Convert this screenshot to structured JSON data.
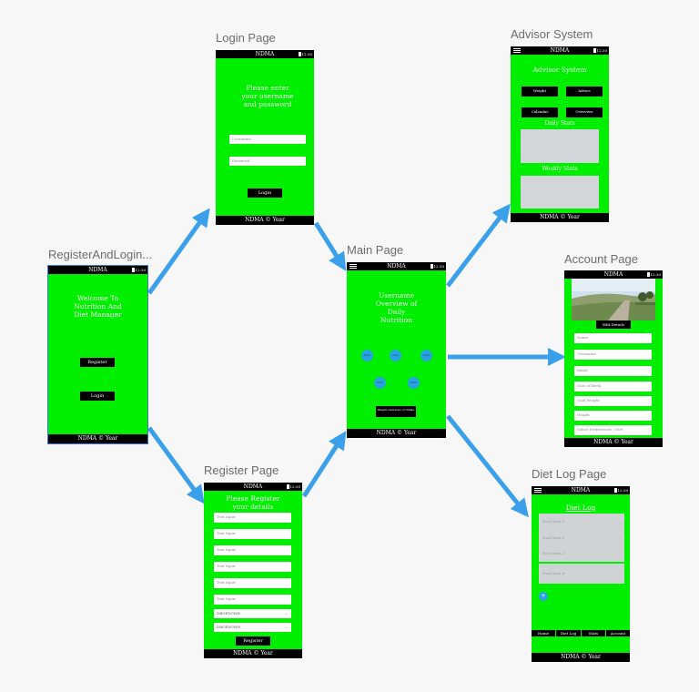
{
  "colors": {
    "screen": "#00ee00",
    "arrow": "#3aa0ea",
    "bar": "#000000"
  },
  "app": {
    "status_title": "NDMA",
    "status_time": "12:30",
    "footer": "NDMA © Year"
  },
  "screens": {
    "register_login": {
      "label": "RegisterAndLogin...",
      "title": "Welcome To Nutrition And Diet Manager",
      "register_button": "Register",
      "login_button": "Login"
    },
    "login": {
      "label": "Login Page",
      "title": "Please enter your username and password",
      "username_placeholder": "Username",
      "password_placeholder": "Password",
      "login_button": "Login"
    },
    "register": {
      "label": "Register Page",
      "title": "Please Register your details",
      "fields": [
        "Text Input",
        "Text Input",
        "Text Input",
        "Text Input",
        "Text Input",
        "Text Input"
      ],
      "dropdowns": [
        "DROPDOWN",
        "DROPDOWN"
      ],
      "register_button": "Register"
    },
    "main": {
      "label": "Main Page",
      "title": "Username Overview of Daily Nutrition",
      "circles": [
        "Item",
        "Item",
        "Item",
        "Item",
        "Item"
      ],
      "overview_button": "Weight Overview of Intake"
    },
    "advisor": {
      "label": "Advisor System",
      "title": "Advisor System",
      "buttons": [
        "Weight",
        "Advice",
        "Calendar",
        "Overview"
      ],
      "daily_stats": "Daily Stats",
      "weekly_stats": "Weekly Stats"
    },
    "account": {
      "label": "Account Page",
      "edit_button": "Edit Details",
      "fields": [
        "Name",
        "Username",
        "Email",
        "Date of Birth",
        "Goal Weight",
        "Height",
        "Select Preferences / Diet"
      ]
    },
    "dietlog": {
      "label": "Diet Log Page",
      "title": "Diet Log",
      "items": [
        "Food Item 1",
        "Food Item 2",
        "Food Item 3",
        "Food Item 4"
      ],
      "add_button": "+",
      "tabs": [
        "Home",
        "Diet Log",
        "Stats",
        "Account"
      ]
    }
  }
}
